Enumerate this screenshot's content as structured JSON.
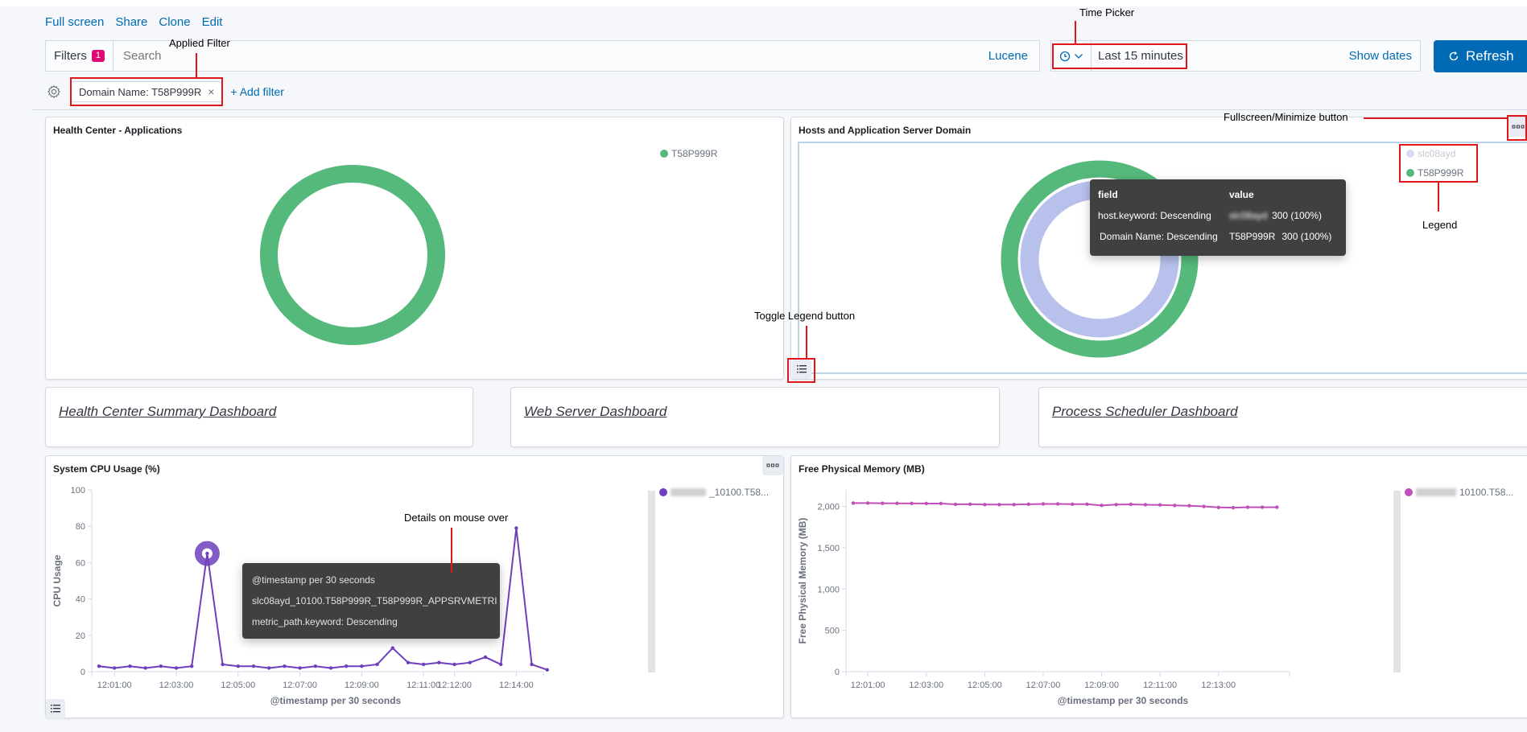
{
  "toolbar": {
    "links": [
      "Full screen",
      "Share",
      "Clone",
      "Edit"
    ]
  },
  "query": {
    "filters_label": "Filters",
    "filters_count": "1",
    "search_placeholder": "Search",
    "language": "Lucene"
  },
  "time": {
    "range": "Last 15 minutes",
    "show_dates": "Show dates",
    "refresh": "Refresh"
  },
  "filter_row": {
    "pill": "Domain Name: T58P999R",
    "add_filter": "+ Add filter"
  },
  "annotations": {
    "applied_filter": "Applied Filter",
    "time_picker": "Time Picker",
    "fullscreen": "Fullscreen/Minimize button",
    "legend": "Legend",
    "toggle_legend": "Toggle Legend button",
    "details": "Details on mouse over"
  },
  "panels": {
    "apps": {
      "title": "Health Center - Applications",
      "legend": [
        {
          "label": "T58P999R",
          "color": "#54b97a"
        }
      ]
    },
    "hosts": {
      "title": "Hosts and Application Server Domain",
      "legend": [
        {
          "label": "slc08ayd",
          "color": "#d6dcf3",
          "muted": true
        },
        {
          "label": "T58P999R",
          "color": "#54b97a"
        }
      ],
      "tooltip": {
        "headers": [
          "field",
          "value"
        ],
        "rows": [
          {
            "field": "host.keyword: Descending",
            "value": "slc08ayd",
            "count": "300 (100%)"
          },
          {
            "field": "Domain Name: Descending",
            "value": "T58P999R",
            "count": "300 (100%)"
          }
        ]
      }
    },
    "links": [
      "Health Center Summary Dashboard",
      "Web Server Dashboard",
      "Process Scheduler Dashboard"
    ],
    "cpu": {
      "title": "System CPU Usage (%)",
      "legend": "slc08ayd_10100.T58...",
      "tooltip": [
        "@timestamp per 30 seconds",
        "slc08ayd_10100.T58P999R_T58P999R_APPSRVMETRI",
        "metric_path.keyword: Descending"
      ]
    },
    "mem": {
      "title": "Free Physical Memory (MB)",
      "legend": "slc08ayd_10100.T58..."
    }
  },
  "chart_data": [
    {
      "type": "line",
      "title": "System CPU Usage (%)",
      "xlabel": "@timestamp per 30 seconds",
      "ylabel": "CPU Usage",
      "ylim": [
        0,
        100
      ],
      "yticks": [
        0,
        20,
        40,
        60,
        80,
        100
      ],
      "xticks": [
        "12:01:00",
        "12:03:00",
        "12:05:00",
        "12:07:00",
        "12:09:00",
        "12:11:00",
        "12:12:00",
        "12:14:00"
      ],
      "xtick_index": [
        1,
        5,
        9,
        13,
        17,
        21,
        23,
        27
      ],
      "color": "#6f3fbd",
      "series": [
        {
          "name": "slc08ayd_10100.T58...",
          "values": [
            3,
            2,
            3,
            2,
            3,
            2,
            3,
            65,
            4,
            3,
            3,
            2,
            3,
            2,
            3,
            2,
            3,
            3,
            4,
            13,
            5,
            4,
            5,
            4,
            5,
            8,
            4,
            79,
            4,
            1
          ]
        }
      ],
      "highlight_index": 7
    },
    {
      "type": "line",
      "title": "Free Physical Memory (MB)",
      "xlabel": "@timestamp per 30 seconds",
      "ylabel": "Free Physical Memory (MB)",
      "ylim": [
        0,
        2200
      ],
      "yticks": [
        0,
        500,
        1000,
        1500,
        2000
      ],
      "ytick_labels": [
        "0",
        "500",
        "1,000",
        "1,500",
        "2,000"
      ],
      "xticks": [
        "12:01:00",
        "12:03:00",
        "12:05:00",
        "12:07:00",
        "12:09:00",
        "12:11:00",
        "12:13:00"
      ],
      "xtick_index": [
        1,
        5,
        9,
        13,
        17,
        21,
        25
      ],
      "color": "#c04fbb",
      "series": [
        {
          "name": "slc08ayd_10100.T58...",
          "values": [
            2040,
            2040,
            2038,
            2037,
            2036,
            2035,
            2035,
            2025,
            2027,
            2022,
            2022,
            2022,
            2026,
            2030,
            2030,
            2027,
            2027,
            2012,
            2022,
            2025,
            2020,
            2018,
            2012,
            2008,
            2000,
            1988,
            1985,
            1990,
            1990,
            1990
          ]
        }
      ]
    }
  ]
}
